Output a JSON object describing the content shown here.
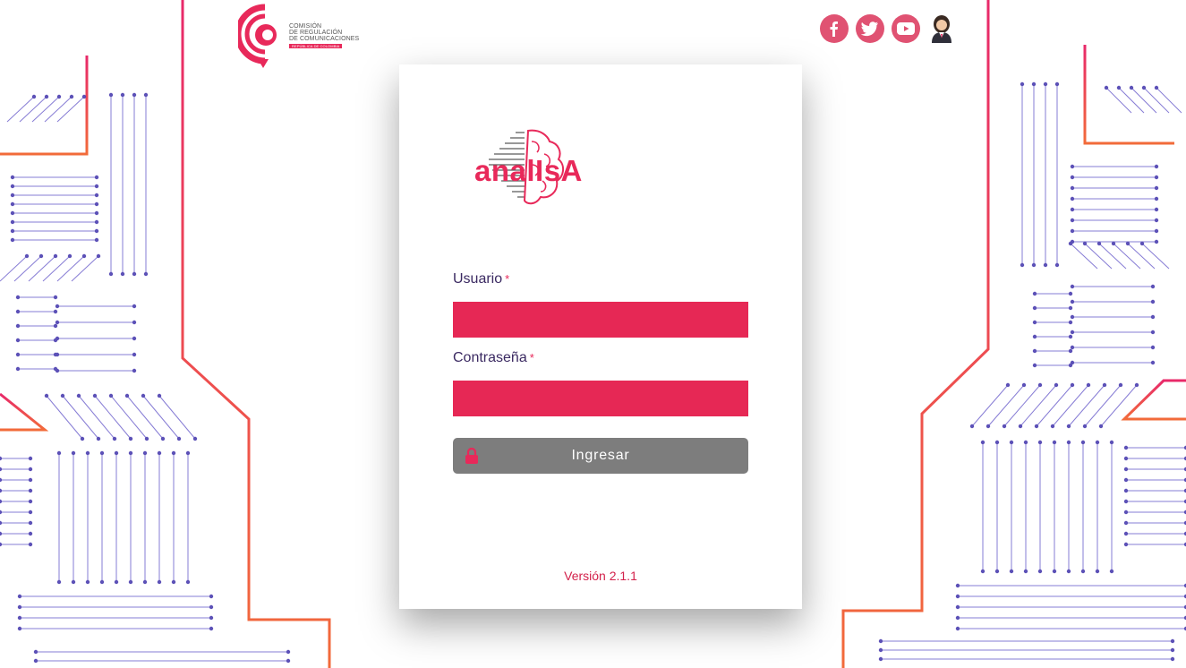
{
  "header": {
    "org_logo": {
      "line1": "COMISIÓN",
      "line2": "DE REGULACIÓN",
      "line3": "DE COMUNICACIONES",
      "line4": "REPÚBLICA DE COLOMBIA"
    },
    "social_links": [
      {
        "icon": "facebook-icon"
      },
      {
        "icon": "twitter-icon"
      },
      {
        "icon": "youtube-icon"
      },
      {
        "icon": "assistant-avatar-icon"
      }
    ]
  },
  "brand": {
    "name": "analIsA",
    "color": "#e8295a"
  },
  "form": {
    "username_label": "Usuario",
    "password_label": "Contraseña",
    "required_marker": "*",
    "username_value": "",
    "password_value": "",
    "field_color": "#e62855",
    "submit_label": "Ingresar",
    "submit_icon": "lock-icon"
  },
  "footer": {
    "version": "Versión 2.1.1"
  },
  "colors": {
    "accent": "#e8295a",
    "circuit": "#5a4fb8",
    "orange": "#f26b3a",
    "button": "#7d7d7d"
  }
}
